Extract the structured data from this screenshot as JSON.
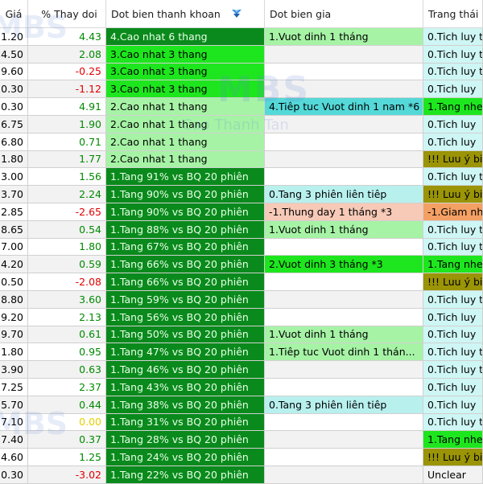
{
  "headers": [
    "Giá",
    "% Thay doi",
    "Dot bien thanh khoan",
    "Dot bien gia",
    "Trang thái"
  ],
  "watermark": {
    "brand": "MBS",
    "name": "Cao Thanh Tan"
  },
  "colors": {
    "dark_green": "#0a8a1c",
    "bright_green": "#1ee61e",
    "lime": "#56ea56",
    "light_green": "#a6f3a6",
    "cyan": "#55d8d8",
    "light_cyan": "#b8f0ee",
    "pale_cyan": "#cef6f4",
    "olive": "#9a9406",
    "salmon": "#f7c9b7",
    "orange": "#f4a064",
    "row_alt": "#f2f2f2",
    "up": "#008a00",
    "down": "#e00000",
    "ref": "#e3d000"
  },
  "rows": [
    {
      "price": "1.20",
      "change": "4.43",
      "dir": "up",
      "liq": "4.Cao nhat 6 thang",
      "liq_bg": "#0a8a1c",
      "gia": "1.Vuot dinh 1 tháng",
      "gia_bg": "#a6f3a6",
      "st": "0.Tich luy t",
      "st_bg": "#cef6f4"
    },
    {
      "price": "4.50",
      "change": "2.08",
      "dir": "up",
      "liq": "3.Cao nhat 3 thang",
      "liq_bg": "#1ee61e",
      "gia": "",
      "gia_bg": "",
      "st": "0.Tich luy t",
      "st_bg": "#cef6f4"
    },
    {
      "price": "9.60",
      "change": "-0.25",
      "dir": "down",
      "liq": "3.Cao nhat 3 thang",
      "liq_bg": "#1ee61e",
      "gia": "",
      "gia_bg": "",
      "st": "0.Tich luy t",
      "st_bg": "#cef6f4"
    },
    {
      "price": "0.30",
      "change": "-1.12",
      "dir": "down",
      "liq": "3.Cao nhat 3 thang",
      "liq_bg": "#1ee61e",
      "gia": "",
      "gia_bg": "",
      "st": "0.Tich luy",
      "st_bg": "#cef6f4"
    },
    {
      "price": "0.30",
      "change": "4.91",
      "dir": "up",
      "liq": "2.Cao nhat 1 thang",
      "liq_bg": "#a6f3a6",
      "gia": "4.Tiêp tuc Vuot dinh 1 nam *6",
      "gia_bg": "#55d8d8",
      "st": "1.Tang nhe",
      "st_bg": "#1ee61e"
    },
    {
      "price": "6.75",
      "change": "1.90",
      "dir": "up",
      "liq": "2.Cao nhat 1 thang",
      "liq_bg": "#a6f3a6",
      "gia": "",
      "gia_bg": "",
      "st": "0.Tich luy",
      "st_bg": "#cef6f4"
    },
    {
      "price": "6.80",
      "change": "0.71",
      "dir": "up",
      "liq": "2.Cao nhat 1 thang",
      "liq_bg": "#a6f3a6",
      "gia": "",
      "gia_bg": "",
      "st": "0.Tich luy",
      "st_bg": "#cef6f4"
    },
    {
      "price": "1.80",
      "change": "1.77",
      "dir": "up",
      "liq": "2.Cao nhat 1 thang",
      "liq_bg": "#a6f3a6",
      "gia": "",
      "gia_bg": "",
      "st": "!!! Luu ý bi",
      "st_bg": "#9a9406"
    },
    {
      "price": "3.00",
      "change": "1.56",
      "dir": "up",
      "liq": "1.Tang 91% vs BQ 20 phiên",
      "liq_bg": "#0a8a1c",
      "gia": "",
      "gia_bg": "",
      "st": "0.Tich luy t",
      "st_bg": "#cef6f4"
    },
    {
      "price": "3.70",
      "change": "2.24",
      "dir": "up",
      "liq": "1.Tang 90% vs BQ 20 phiên",
      "liq_bg": "#0a8a1c",
      "gia": "0.Tang 3 phiên liên tiêp",
      "gia_bg": "#b8f0ee",
      "st": "!!! Luu ý bi",
      "st_bg": "#9a9406"
    },
    {
      "price": "2.85",
      "change": "-2.65",
      "dir": "down",
      "liq": "1.Tang 90% vs BQ 20 phiên",
      "liq_bg": "#0a8a1c",
      "gia": "-1.Thung day 1 tháng *3",
      "gia_bg": "#f7c9b7",
      "st": "-1.Giam nh",
      "st_bg": "#f4a064"
    },
    {
      "price": "8.65",
      "change": "0.54",
      "dir": "up",
      "liq": "1.Tang 88% vs BQ 20 phiên",
      "liq_bg": "#0a8a1c",
      "gia": "1.Vuot dinh 1 tháng",
      "gia_bg": "#a6f3a6",
      "st": "0.Tich luy t",
      "st_bg": "#cef6f4"
    },
    {
      "price": "7.00",
      "change": "1.80",
      "dir": "up",
      "liq": "1.Tang 67% vs BQ 20 phiên",
      "liq_bg": "#0a8a1c",
      "gia": "",
      "gia_bg": "",
      "st": "0.Tich luy t",
      "st_bg": "#cef6f4"
    },
    {
      "price": "4.20",
      "change": "0.59",
      "dir": "up",
      "liq": "1.Tang 66% vs BQ 20 phiên",
      "liq_bg": "#0a8a1c",
      "gia": "2.Vuot dinh 3 tháng *3",
      "gia_bg": "#1ee61e",
      "st": "1.Tang nhe",
      "st_bg": "#1ee61e"
    },
    {
      "price": "0.50",
      "change": "-2.08",
      "dir": "down",
      "liq": "1.Tang 66% vs BQ 20 phiên",
      "liq_bg": "#0a8a1c",
      "gia": "",
      "gia_bg": "",
      "st": "!!! Luu ý bi",
      "st_bg": "#9a9406"
    },
    {
      "price": "8.80",
      "change": "3.60",
      "dir": "up",
      "liq": "1.Tang 59% vs BQ 20 phiên",
      "liq_bg": "#0a8a1c",
      "gia": "",
      "gia_bg": "",
      "st": "0.Tich luy t",
      "st_bg": "#cef6f4"
    },
    {
      "price": "9.20",
      "change": "2.13",
      "dir": "up",
      "liq": "1.Tang 56% vs BQ 20 phiên",
      "liq_bg": "#0a8a1c",
      "gia": "",
      "gia_bg": "",
      "st": "0.Tich luy",
      "st_bg": "#cef6f4"
    },
    {
      "price": "9.70",
      "change": "0.61",
      "dir": "up",
      "liq": "1.Tang 50% vs BQ 20 phiên",
      "liq_bg": "#0a8a1c",
      "gia": "1.Vuot dinh 1 tháng",
      "gia_bg": "#a6f3a6",
      "st": "0.Tich luy",
      "st_bg": "#cef6f4"
    },
    {
      "price": "1.80",
      "change": "0.95",
      "dir": "up",
      "liq": "1.Tang 47% vs BQ 20 phiên",
      "liq_bg": "#0a8a1c",
      "gia": "1.Tiêp tuc Vuot dinh 1 thán...",
      "gia_bg": "#a6f3a6",
      "st": "0.Tich luy t",
      "st_bg": "#cef6f4"
    },
    {
      "price": "3.90",
      "change": "0.63",
      "dir": "up",
      "liq": "1.Tang 46% vs BQ 20 phiên",
      "liq_bg": "#0a8a1c",
      "gia": "",
      "gia_bg": "",
      "st": "0.Tich luy t",
      "st_bg": "#cef6f4"
    },
    {
      "price": "7.25",
      "change": "2.37",
      "dir": "up",
      "liq": "1.Tang 43% vs BQ 20 phiên",
      "liq_bg": "#0a8a1c",
      "gia": "",
      "gia_bg": "",
      "st": "0.Tich luy",
      "st_bg": "#cef6f4"
    },
    {
      "price": "5.70",
      "change": "0.44",
      "dir": "up",
      "liq": "1.Tang 38% vs BQ 20 phiên",
      "liq_bg": "#0a8a1c",
      "gia": "0.Tang 3 phiên liên tiêp",
      "gia_bg": "#b8f0ee",
      "st": "0.Tich luy",
      "st_bg": "#cef6f4"
    },
    {
      "price": "7.10",
      "change": "0.00",
      "dir": "ref",
      "liq": "1.Tang 31% vs BQ 20 phiên",
      "liq_bg": "#0a8a1c",
      "gia": "",
      "gia_bg": "",
      "st": "0.Tich luy t",
      "st_bg": "#cef6f4"
    },
    {
      "price": "7.40",
      "change": "0.37",
      "dir": "up",
      "liq": "1.Tang 28% vs BQ 20 phiên",
      "liq_bg": "#0a8a1c",
      "gia": "",
      "gia_bg": "",
      "st": "1.Tang nhe",
      "st_bg": "#1ee61e"
    },
    {
      "price": "4.60",
      "change": "1.25",
      "dir": "up",
      "liq": "1.Tang 24% vs BQ 20 phiên",
      "liq_bg": "#0a8a1c",
      "gia": "",
      "gia_bg": "",
      "st": "!!! Luu ý bi",
      "st_bg": "#9a9406"
    },
    {
      "price": "0.30",
      "change": "-3.02",
      "dir": "down",
      "liq": "1.Tang 22% vs BQ 20 phiên",
      "liq_bg": "#0a8a1c",
      "gia": "",
      "gia_bg": "",
      "st": "Unclear",
      "st_bg": ""
    }
  ]
}
